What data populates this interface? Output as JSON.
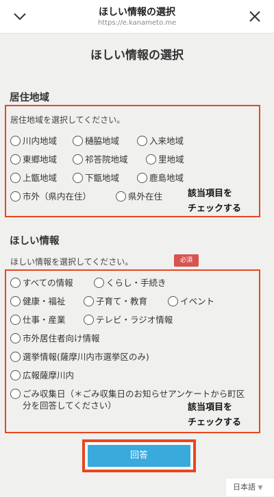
{
  "header": {
    "title": "ほしい情報の選択",
    "url": "https://e.kaname­to.me"
  },
  "page": {
    "heading": "ほしい情報の選択"
  },
  "residence": {
    "title": "居住地域",
    "instruction": "居住地域を選択してください。",
    "options": [
      "川内地域",
      "樋脇地域",
      "入来地域",
      "東郷地域",
      "祁答院地域",
      "里地域",
      "上甑地域",
      "下甑地域",
      "鹿島地域",
      "市外（県内在住）",
      "県外在住"
    ]
  },
  "info": {
    "title": "ほしい情報",
    "instruction": "ほしい情報を選択してください。",
    "required_badge": "必須",
    "options": [
      "すべての情報",
      "くらし・手続き",
      "健康・福祉",
      "子育て・教育",
      "イベント",
      "仕事・産業",
      "テレビ・ラジオ情報",
      "市外居住者向け情報",
      "選挙情報(薩摩川内市選挙区のみ)",
      "広報薩摩川内",
      "ごみ収集日（＊ごみ収集日のお知らせアンケートから町区分を回答してください）"
    ]
  },
  "annotations": {
    "line1": "該当項目を",
    "line2": "チェックする"
  },
  "submit_label": "回答",
  "language": "日本語",
  "colors": {
    "accent": "#e8461d",
    "button": "#3aa9dc",
    "badge": "#d9534f"
  }
}
